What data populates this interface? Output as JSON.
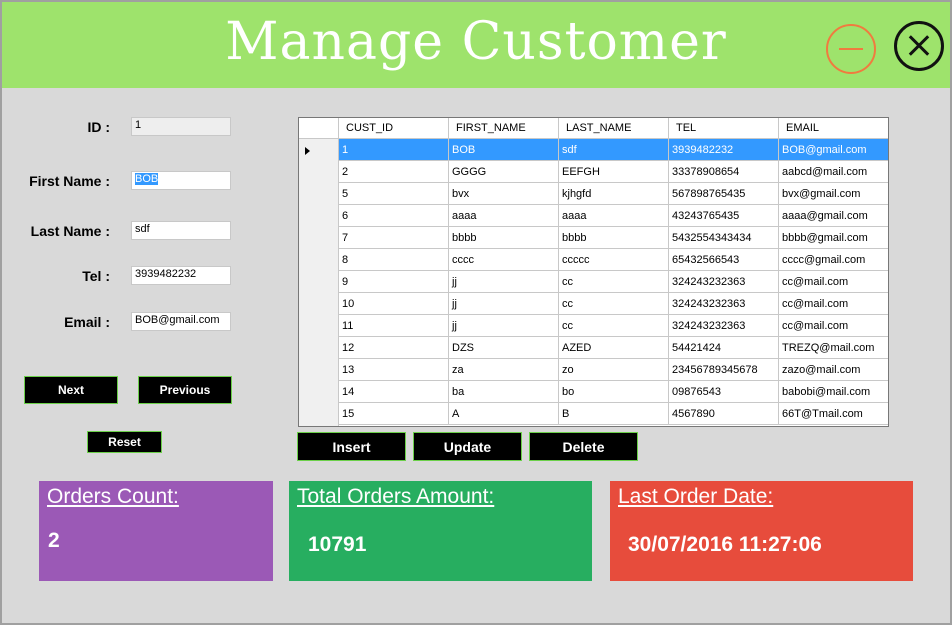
{
  "window": {
    "title": "Manage Customer",
    "minimize_icon": "minus-circle-icon",
    "close_icon": "x-circle-icon"
  },
  "form": {
    "id_label": "ID :",
    "id_value": "1",
    "first_name_label": "First Name :",
    "first_name_value": "BOB",
    "last_name_label": "Last Name :",
    "last_name_value": "sdf",
    "tel_label": "Tel :",
    "tel_value": "3939482232",
    "email_label": "Email :",
    "email_value": "BOB@gmail.com"
  },
  "nav": {
    "next_label": "Next",
    "previous_label": "Previous",
    "reset_label": "Reset"
  },
  "grid": {
    "columns": [
      "CUST_ID",
      "FIRST_NAME",
      "LAST_NAME",
      "TEL",
      "EMAIL"
    ],
    "selected_index": 0,
    "rows": [
      [
        "1",
        "BOB",
        "sdf",
        "3939482232",
        "BOB@gmail.com"
      ],
      [
        "2",
        "GGGG",
        "EEFGH",
        "33378908654",
        "aabcd@mail.com"
      ],
      [
        "5",
        "bvx",
        "kjhgfd",
        "567898765435",
        "bvx@gmail.com"
      ],
      [
        "6",
        "aaaa",
        "aaaa",
        "43243765435",
        "aaaa@gmail.com"
      ],
      [
        "7",
        "bbbb",
        "bbbb",
        "5432554343434",
        "bbbb@gmail.com"
      ],
      [
        "8",
        "cccc",
        "ccccc",
        "65432566543",
        "cccc@gmail.com"
      ],
      [
        "9",
        "jj",
        "cc",
        "324243232363",
        "cc@mail.com"
      ],
      [
        "10",
        "jj",
        "cc",
        "324243232363",
        "cc@mail.com"
      ],
      [
        "11",
        "jj",
        "cc",
        "324243232363",
        "cc@mail.com"
      ],
      [
        "12",
        "DZS",
        "AZED",
        "54421424",
        "TREZQ@mail.com"
      ],
      [
        "13",
        "za",
        "zo",
        "23456789345678",
        "zazo@mail.com"
      ],
      [
        "14",
        "ba",
        "bo",
        "09876543",
        "babobi@mail.com"
      ],
      [
        "15",
        "A",
        "B",
        "4567890",
        "66T@Tmail.com"
      ]
    ]
  },
  "actions": {
    "insert_label": "Insert",
    "update_label": "Update",
    "delete_label": "Delete"
  },
  "stats": {
    "orders_count_label": "Orders Count:",
    "orders_count_value": "2",
    "orders_count_color": "#9b59b6",
    "total_amount_label": "Total Orders Amount:",
    "total_amount_value": "10791",
    "total_amount_color": "#27ae60",
    "last_order_label": "Last Order Date:",
    "last_order_value": "30/07/2016 11:27:06",
    "last_order_color": "#e74c3c"
  },
  "colors": {
    "header": "#9ee36c",
    "selection": "#3399ff",
    "button_border": "#6cd04a"
  }
}
